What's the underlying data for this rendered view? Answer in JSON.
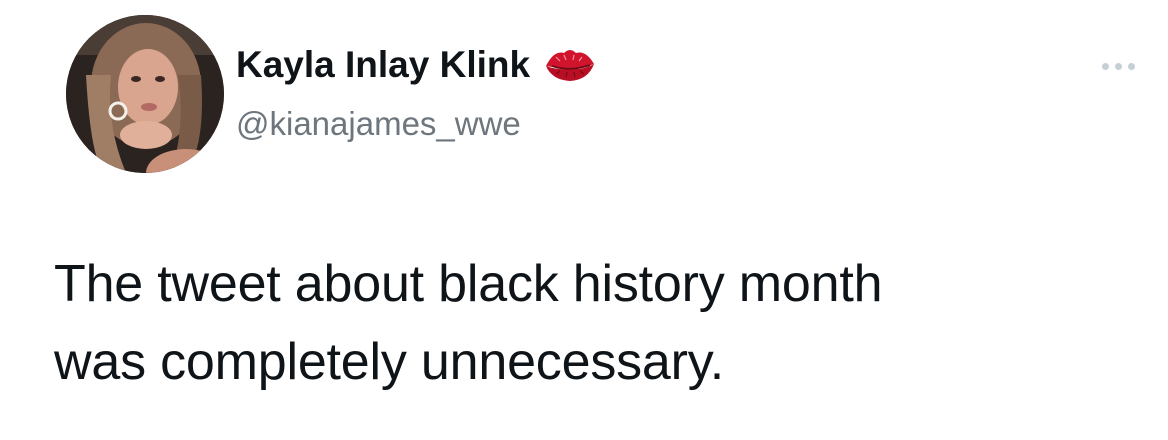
{
  "tweet": {
    "author": {
      "display_name": "Kayla Inlay Klink",
      "handle": "@kianajames_wwe",
      "avatar_icon": "profile-photo",
      "badge_icon": "kiss-lips-icon"
    },
    "more_menu_icon": "more-horizontal-icon",
    "text": "The tweet about black history month\nwas completely unnecessary."
  },
  "colors": {
    "text_primary": "#0f1419",
    "text_secondary": "#6e767d",
    "menu_dots": "#c4cfd6",
    "lips_red": "#d0142b",
    "background": "#ffffff"
  }
}
